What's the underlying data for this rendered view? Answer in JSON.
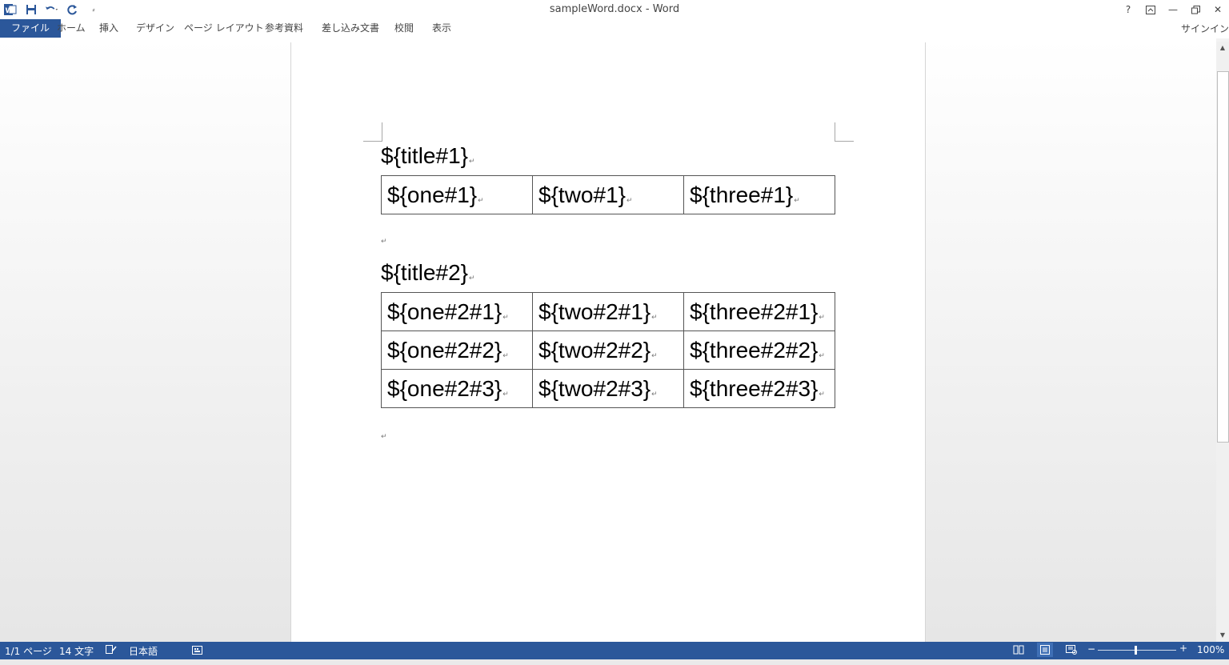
{
  "window": {
    "title": "sampleWord.docx - Word",
    "signin": "サインイン"
  },
  "qat": {
    "icons": [
      "word-logo-icon",
      "save-icon",
      "undo-icon",
      "redo-icon",
      "customize-qat-icon"
    ],
    "customize_glyph": "⸗"
  },
  "window_controls": [
    "help-icon",
    "ribbon-display-icon",
    "minimize-icon",
    "restore-icon",
    "close-icon"
  ],
  "window_glyphs": {
    "help": "?",
    "minimize": "—",
    "close": "✕"
  },
  "tabs": [
    "ファイル",
    "ホーム",
    "挿入",
    "デザイン",
    "ページ レイアウト",
    "参考資料",
    "差し込み文書",
    "校閲",
    "表示"
  ],
  "document": {
    "mark": "↵",
    "title1": "${title#1}",
    "table1": [
      [
        "${one#1}",
        "${two#1}",
        "${three#1}"
      ]
    ],
    "title2": "${title#2}",
    "table2": [
      [
        "${one#2#1}",
        "${two#2#1}",
        "${three#2#1}"
      ],
      [
        "${one#2#2}",
        "${two#2#2}",
        "${three#2#2}"
      ],
      [
        "${one#2#3}",
        "${two#2#3}",
        "${three#2#3}"
      ]
    ]
  },
  "status": {
    "page": "1/1 ページ",
    "words": "14 文字",
    "language": "日本語",
    "zoom": "100%",
    "zoom_minus": "−",
    "zoom_plus": "+"
  },
  "colors": {
    "accent": "#2b579a"
  }
}
